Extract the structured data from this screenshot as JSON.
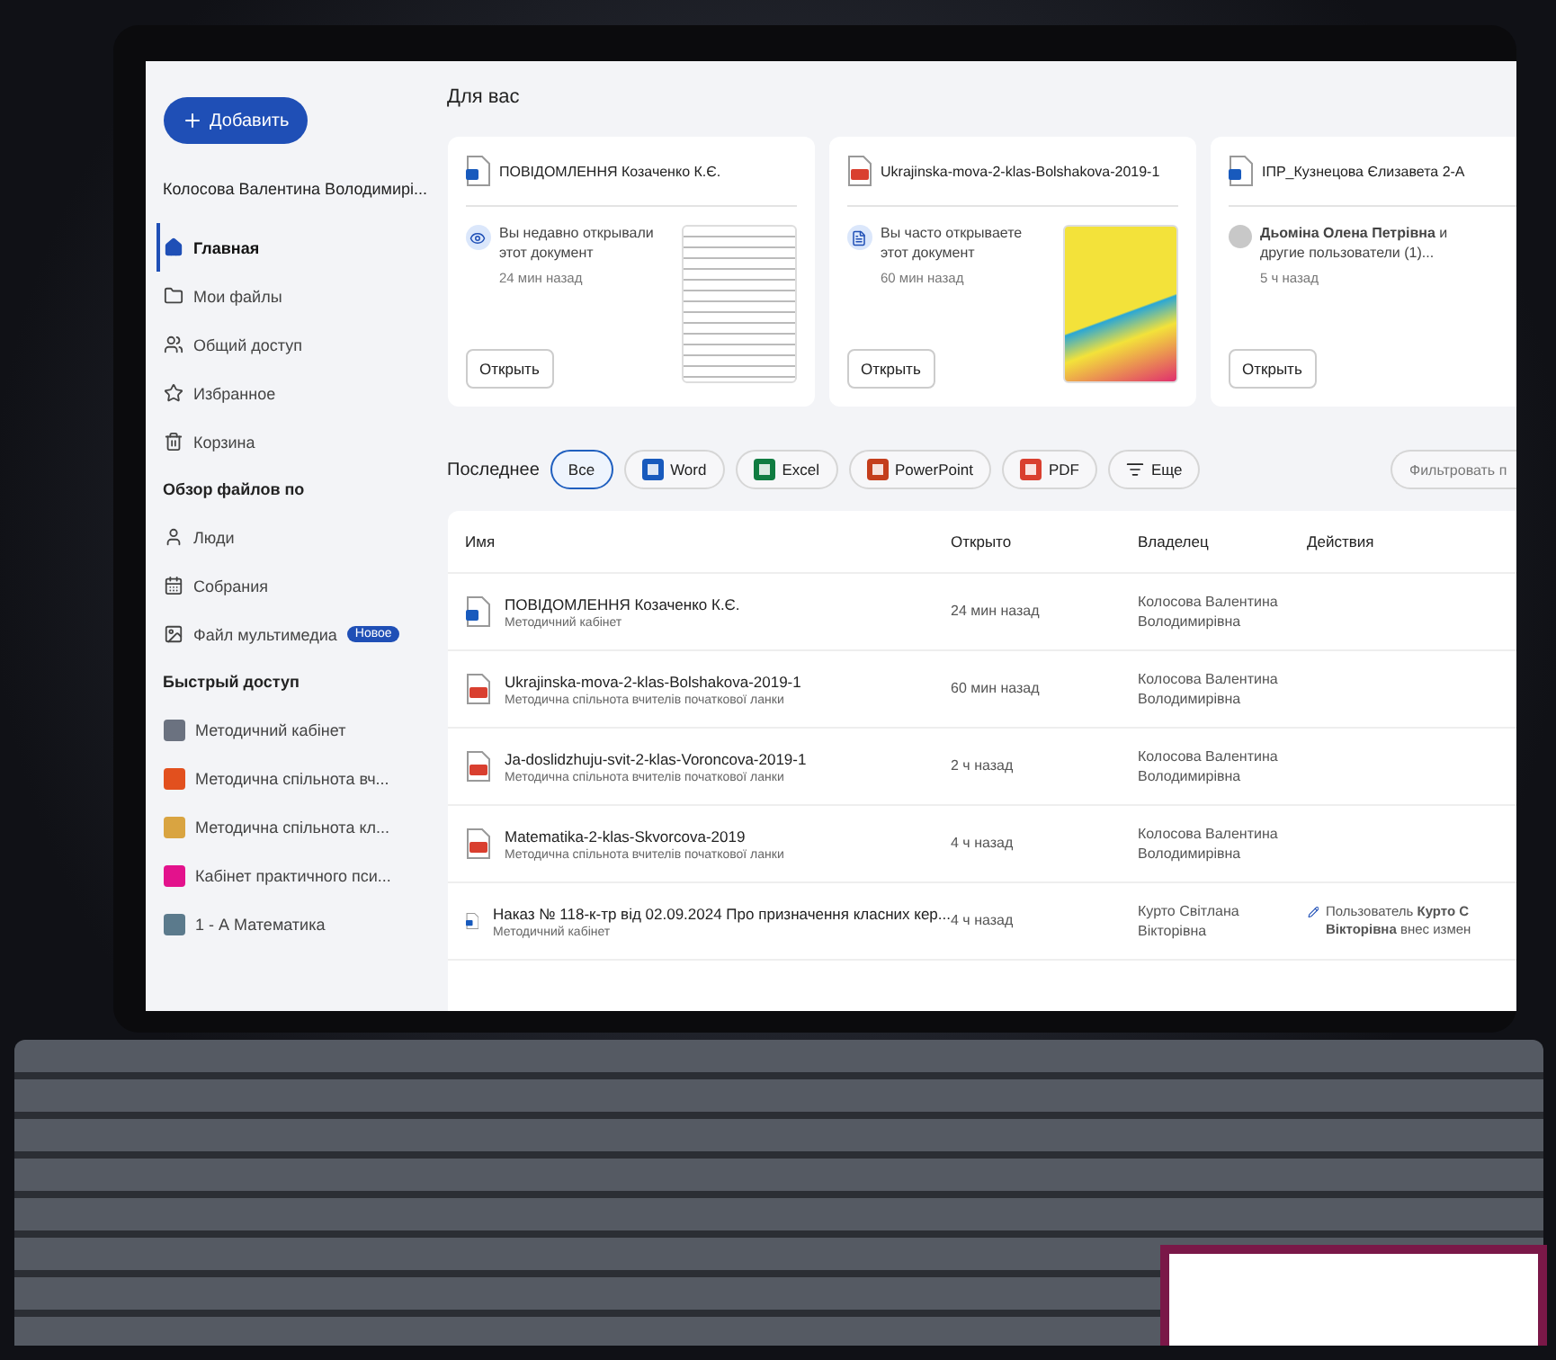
{
  "sidebar": {
    "add_button": "Добавить",
    "user": "Колосова Валентина Володимирі...",
    "nav": [
      {
        "label": "Главная",
        "selected": true
      },
      {
        "label": "Мои файлы",
        "selected": false
      },
      {
        "label": "Общий доступ",
        "selected": false
      },
      {
        "label": "Избранное",
        "selected": false
      },
      {
        "label": "Корзина",
        "selected": false
      }
    ],
    "browse_title": "Обзор файлов по",
    "browse": [
      {
        "label": "Люди"
      },
      {
        "label": "Собрания"
      },
      {
        "label": "Файл мультимедиа",
        "badge": "Новое"
      }
    ],
    "quick_title": "Быстрый доступ",
    "quick": [
      {
        "label": "Методичний кабінет",
        "color": "#6b7280"
      },
      {
        "label": "Методична спільнота вч...",
        "color": "#e2501e"
      },
      {
        "label": "Методична спільнота кл...",
        "color": "#d9a441"
      },
      {
        "label": "Кабінет практичного пси...",
        "color": "#e3128c"
      },
      {
        "label": "1 - А Математика",
        "color": "#5b7a8c"
      }
    ]
  },
  "for_you": {
    "title": "Для вас",
    "cards": [
      {
        "kind": "word",
        "name": "ПОВІДОМЛЕННЯ Козаченко К.Є.",
        "reason": "Вы недавно открывали этот документ",
        "time": "24 мин назад",
        "button": "Открыть"
      },
      {
        "kind": "pdf",
        "name": "Ukrajinska-mova-2-klas-Bolshakova-2019-1",
        "reason": "Вы часто открываете этот документ",
        "time": "60 мин назад",
        "button": "Открыть"
      },
      {
        "kind": "word",
        "name": "ІПР_Кузнецова Єлизавета 2-А",
        "reason_bold": "Дьоміна Олена Петрівна",
        "reason": "и другие пользователи (1)...",
        "time": "5 ч назад",
        "button": "Открыть"
      }
    ]
  },
  "recent": {
    "title": "Последнее",
    "filters": [
      {
        "label": "Все",
        "selected": true
      },
      {
        "label": "Word",
        "selected": false
      },
      {
        "label": "Excel",
        "selected": false
      },
      {
        "label": "PowerPoint",
        "selected": false
      },
      {
        "label": "PDF",
        "selected": false
      },
      {
        "label": "Еще",
        "selected": false
      }
    ],
    "filter_placeholder": "Фильтровать п",
    "columns": [
      "Имя",
      "Открыто",
      "Владелец",
      "Действия"
    ],
    "rows": [
      {
        "kind": "word",
        "name": "ПОВІДОМЛЕННЯ Козаченко К.Є.",
        "location": "Методичний кабінет",
        "opened": "24 мин назад",
        "owner": "Колосова Валентина Володимирівна"
      },
      {
        "kind": "pdf",
        "name": "Ukrajinska-mova-2-klas-Bolshakova-2019-1",
        "location": "Методична спільнота вчителів початкової ланки",
        "opened": "60 мин назад",
        "owner": "Колосова Валентина Володимирівна"
      },
      {
        "kind": "pdf",
        "name": "Ja-doslidzhuju-svit-2-klas-Voroncova-2019-1",
        "location": "Методична спільнота вчителів початкової ланки",
        "opened": "2 ч назад",
        "owner": "Колосова Валентина Володимирівна"
      },
      {
        "kind": "pdf",
        "name": "Matematika-2-klas-Skvorcova-2019",
        "location": "Методична спільнота вчителів початкової ланки",
        "opened": "4 ч назад",
        "owner": "Колосова Валентина Володимирівна"
      },
      {
        "kind": "word",
        "name": "Наказ № 118-к-тр від 02.09.2024 Про призначення класних кер...",
        "location": "Методичний кабінет",
        "opened": "4 ч назад",
        "owner": "Курто Світлана Вікторівна",
        "action": "Пользователь **Курто С** **Вікторівна** внес измен"
      }
    ]
  }
}
